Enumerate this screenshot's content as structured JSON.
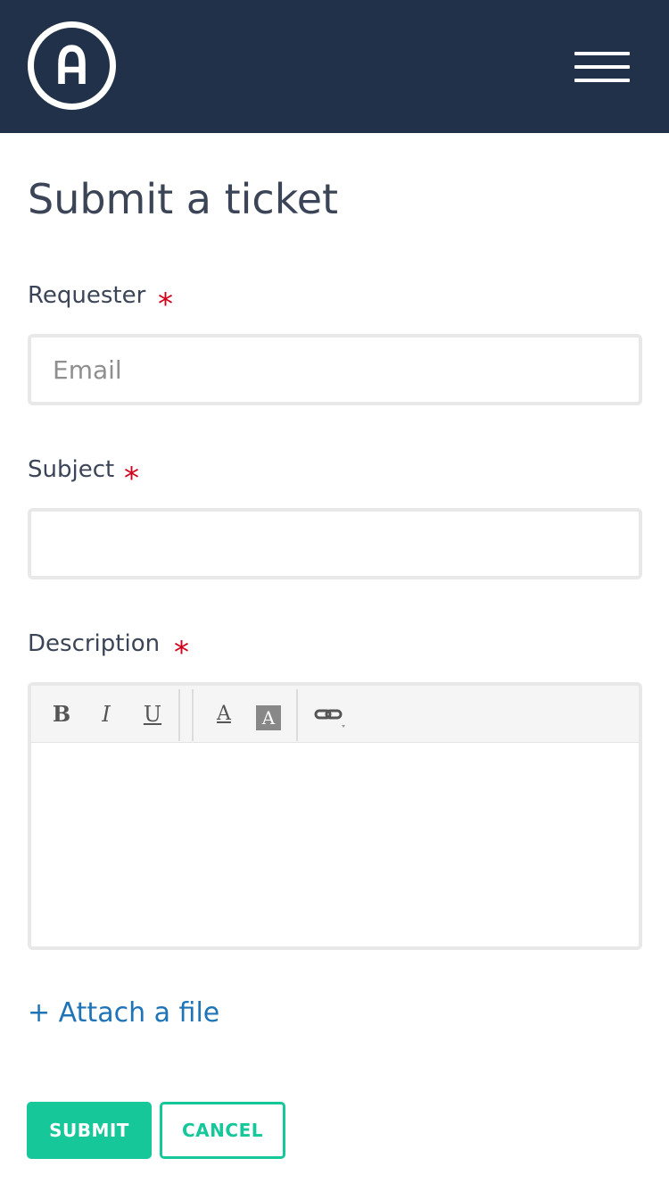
{
  "header": {
    "logo_letter": "A",
    "logo_icon": "circle-a-logo",
    "menu_icon": "hamburger-menu-icon",
    "background_color": "#213149"
  },
  "page": {
    "title": "Submit a ticket"
  },
  "form": {
    "required_marker": "*",
    "requester": {
      "label": "Requester",
      "placeholder": "Email",
      "value": ""
    },
    "subject": {
      "label": "Subject",
      "placeholder": "",
      "value": ""
    },
    "description": {
      "label": "Description",
      "toolbar": {
        "bold": "B",
        "italic": "I",
        "underline": "U",
        "font_color": "A",
        "background_color": "A",
        "link_icon": "link-icon"
      },
      "value": ""
    },
    "attach_label": "+ Attach a file",
    "submit_label": "SUBMIT",
    "cancel_label": "CANCEL"
  },
  "colors": {
    "accent": "#16c79a",
    "link": "#1f73b7",
    "required": "#d0021b",
    "text": "#3b4557"
  }
}
